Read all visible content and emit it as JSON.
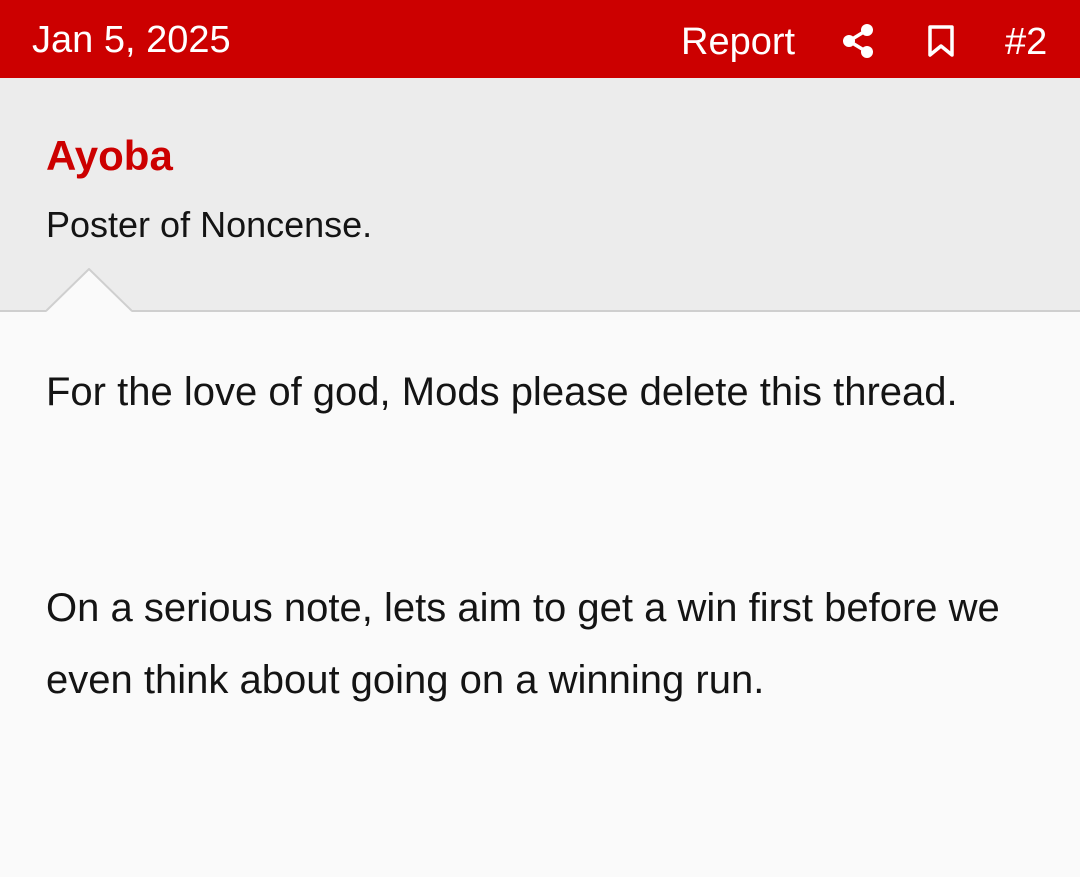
{
  "header": {
    "date": "Jan 5, 2025",
    "report_label": "Report",
    "post_number": "#2",
    "icons": [
      "share-icon",
      "bookmark-icon"
    ]
  },
  "user": {
    "name": "Ayoba",
    "title": "Poster of Noncense."
  },
  "post": {
    "paragraphs": [
      "For the love of god, Mods please delete this thread.",
      "On a serious note, lets aim to get a win first before we even think about going on a winning run."
    ]
  },
  "colors": {
    "accent": "#cc0000",
    "header_text": "#ffffff",
    "user_block_bg": "#ececec",
    "body_bg": "#fafafa",
    "text": "#141414"
  }
}
